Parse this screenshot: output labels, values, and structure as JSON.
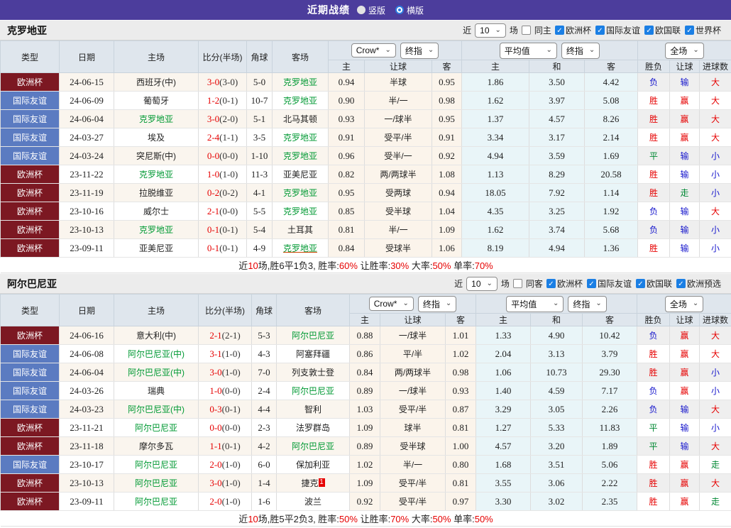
{
  "top_bar": {
    "title": "近期战绩",
    "radios": [
      {
        "label": "竖版",
        "selected": false
      },
      {
        "label": "横版",
        "selected": true
      }
    ]
  },
  "common": {
    "table_headers": {
      "type": "类型",
      "date": "日期",
      "home": "主场",
      "score": "比分(半场)",
      "corner": "角球",
      "away": "客场",
      "sub": [
        "主",
        "让球",
        "客",
        "主",
        "和",
        "客",
        "胜负",
        "让球",
        "进球数"
      ]
    },
    "selects": {
      "odds_source": "Crow*",
      "final1": "终指",
      "avg": "平均值",
      "final2": "终指",
      "scope": "全场"
    }
  },
  "sections": [
    {
      "team": "克罗地亚",
      "recent_label": "近",
      "recent_count": "10",
      "games_label": "场",
      "same_label": "同主",
      "leagues": [
        "欧洲杯",
        "国际友谊",
        "欧国联",
        "世界杯"
      ],
      "rows": [
        {
          "type": "欧洲杯",
          "tc": "e",
          "date": "24-06-15",
          "home": "西班牙(中)",
          "home_green": false,
          "score": "3-0",
          "half": "(3-0)",
          "corner": "5-0",
          "away": "克罗地亚",
          "away_green": true,
          "away_underline": false,
          "away_badge": "",
          "odds_home": "0.94",
          "handicap": "半球",
          "odds_away": "0.95",
          "avg_home": "1.86",
          "avg_draw": "3.50",
          "avg_away": "4.42",
          "res_wdl": "负",
          "res_wdl_c": "l",
          "res_let": "输",
          "res_let_c": "l",
          "res_goal": "大",
          "res_goal_c": "w"
        },
        {
          "type": "国际友谊",
          "tc": "f",
          "date": "24-06-09",
          "home": "葡萄牙",
          "home_green": false,
          "score": "1-2",
          "half": "(0-1)",
          "corner": "10-7",
          "away": "克罗地亚",
          "away_green": true,
          "away_underline": false,
          "away_badge": "",
          "odds_home": "0.90",
          "handicap": "半/一",
          "odds_away": "0.98",
          "avg_home": "1.62",
          "avg_draw": "3.97",
          "avg_away": "5.08",
          "res_wdl": "胜",
          "res_wdl_c": "w",
          "res_let": "赢",
          "res_let_c": "w",
          "res_goal": "大",
          "res_goal_c": "w"
        },
        {
          "type": "国际友谊",
          "tc": "f",
          "date": "24-06-04",
          "home": "克罗地亚",
          "home_green": true,
          "score": "3-0",
          "half": "(2-0)",
          "corner": "5-1",
          "away": "北马其顿",
          "away_green": false,
          "away_underline": false,
          "away_badge": "",
          "odds_home": "0.93",
          "handicap": "一/球半",
          "odds_away": "0.95",
          "avg_home": "1.37",
          "avg_draw": "4.57",
          "avg_away": "8.26",
          "res_wdl": "胜",
          "res_wdl_c": "w",
          "res_let": "赢",
          "res_let_c": "w",
          "res_goal": "大",
          "res_goal_c": "w"
        },
        {
          "type": "国际友谊",
          "tc": "f",
          "date": "24-03-27",
          "home": "埃及",
          "home_green": false,
          "score": "2-4",
          "half": "(1-1)",
          "corner": "3-5",
          "away": "克罗地亚",
          "away_green": true,
          "away_underline": false,
          "away_badge": "",
          "odds_home": "0.91",
          "handicap": "受平/半",
          "odds_away": "0.91",
          "avg_home": "3.34",
          "avg_draw": "3.17",
          "avg_away": "2.14",
          "res_wdl": "胜",
          "res_wdl_c": "w",
          "res_let": "赢",
          "res_let_c": "w",
          "res_goal": "大",
          "res_goal_c": "w"
        },
        {
          "type": "国际友谊",
          "tc": "f",
          "date": "24-03-24",
          "home": "突尼斯(中)",
          "home_green": false,
          "score": "0-0",
          "half": "(0-0)",
          "corner": "1-10",
          "away": "克罗地亚",
          "away_green": true,
          "away_underline": false,
          "away_badge": "",
          "odds_home": "0.96",
          "handicap": "受半/一",
          "odds_away": "0.92",
          "avg_home": "4.94",
          "avg_draw": "3.59",
          "avg_away": "1.69",
          "res_wdl": "平",
          "res_wdl_c": "d",
          "res_let": "输",
          "res_let_c": "l",
          "res_goal": "小",
          "res_goal_c": "l"
        },
        {
          "type": "欧洲杯",
          "tc": "e",
          "date": "23-11-22",
          "home": "克罗地亚",
          "home_green": true,
          "score": "1-0",
          "half": "(1-0)",
          "corner": "11-3",
          "away": "亚美尼亚",
          "away_green": false,
          "away_underline": false,
          "away_badge": "",
          "odds_home": "0.82",
          "handicap": "两/两球半",
          "odds_away": "1.08",
          "avg_home": "1.13",
          "avg_draw": "8.29",
          "avg_away": "20.58",
          "res_wdl": "胜",
          "res_wdl_c": "w",
          "res_let": "输",
          "res_let_c": "l",
          "res_goal": "小",
          "res_goal_c": "l"
        },
        {
          "type": "欧洲杯",
          "tc": "e",
          "date": "23-11-19",
          "home": "拉脱维亚",
          "home_green": false,
          "score": "0-2",
          "half": "(0-2)",
          "corner": "4-1",
          "away": "克罗地亚",
          "away_green": true,
          "away_underline": false,
          "away_badge": "",
          "odds_home": "0.95",
          "handicap": "受两球",
          "odds_away": "0.94",
          "avg_home": "18.05",
          "avg_draw": "7.92",
          "avg_away": "1.14",
          "res_wdl": "胜",
          "res_wdl_c": "w",
          "res_let": "走",
          "res_let_c": "d",
          "res_goal": "小",
          "res_goal_c": "l"
        },
        {
          "type": "欧洲杯",
          "tc": "e",
          "date": "23-10-16",
          "home": "威尔士",
          "home_green": false,
          "score": "2-1",
          "half": "(0-0)",
          "corner": "5-5",
          "away": "克罗地亚",
          "away_green": true,
          "away_underline": false,
          "away_badge": "",
          "odds_home": "0.85",
          "handicap": "受半球",
          "odds_away": "1.04",
          "avg_home": "4.35",
          "avg_draw": "3.25",
          "avg_away": "1.92",
          "res_wdl": "负",
          "res_wdl_c": "l",
          "res_let": "输",
          "res_let_c": "l",
          "res_goal": "大",
          "res_goal_c": "w"
        },
        {
          "type": "欧洲杯",
          "tc": "e",
          "date": "23-10-13",
          "home": "克罗地亚",
          "home_green": true,
          "score": "0-1",
          "half": "(0-1)",
          "corner": "5-4",
          "away": "土耳其",
          "away_green": false,
          "away_underline": false,
          "away_badge": "",
          "odds_home": "0.81",
          "handicap": "半/一",
          "odds_away": "1.09",
          "avg_home": "1.62",
          "avg_draw": "3.74",
          "avg_away": "5.68",
          "res_wdl": "负",
          "res_wdl_c": "l",
          "res_let": "输",
          "res_let_c": "l",
          "res_goal": "小",
          "res_goal_c": "l"
        },
        {
          "type": "欧洲杯",
          "tc": "e",
          "date": "23-09-11",
          "home": "亚美尼亚",
          "home_green": false,
          "score": "0-1",
          "half": "(0-1)",
          "corner": "4-9",
          "away": "克罗地亚",
          "away_green": true,
          "away_underline": true,
          "away_badge": "",
          "odds_home": "0.84",
          "handicap": "受球半",
          "odds_away": "1.06",
          "avg_home": "8.19",
          "avg_draw": "4.94",
          "avg_away": "1.36",
          "res_wdl": "胜",
          "res_wdl_c": "w",
          "res_let": "输",
          "res_let_c": "l",
          "res_goal": "小",
          "res_goal_c": "l"
        }
      ],
      "summary": [
        {
          "text": "近",
          "red": false
        },
        {
          "text": "10",
          "red": true
        },
        {
          "text": "场,胜6平1负3, 胜率:",
          "red": false
        },
        {
          "text": "60%",
          "red": true
        },
        {
          "text": " 让胜率:",
          "red": false
        },
        {
          "text": "30%",
          "red": true
        },
        {
          "text": " 大率:",
          "red": false
        },
        {
          "text": "50%",
          "red": true
        },
        {
          "text": " 单率:",
          "red": false
        },
        {
          "text": "70%",
          "red": true
        }
      ]
    },
    {
      "team": "阿尔巴尼亚",
      "recent_label": "近",
      "recent_count": "10",
      "games_label": "场",
      "same_label": "同客",
      "leagues": [
        "欧洲杯",
        "国际友谊",
        "欧国联",
        "欧洲预选"
      ],
      "rows": [
        {
          "type": "欧洲杯",
          "tc": "e",
          "date": "24-06-16",
          "home": "意大利(中)",
          "home_green": false,
          "score": "2-1",
          "half": "(2-1)",
          "corner": "5-3",
          "away": "阿尔巴尼亚",
          "away_green": true,
          "away_underline": false,
          "away_badge": "",
          "odds_home": "0.88",
          "handicap": "一/球半",
          "odds_away": "1.01",
          "avg_home": "1.33",
          "avg_draw": "4.90",
          "avg_away": "10.42",
          "res_wdl": "负",
          "res_wdl_c": "l",
          "res_let": "赢",
          "res_let_c": "w",
          "res_goal": "大",
          "res_goal_c": "w"
        },
        {
          "type": "国际友谊",
          "tc": "f",
          "date": "24-06-08",
          "home": "阿尔巴尼亚(中)",
          "home_green": true,
          "score": "3-1",
          "half": "(1-0)",
          "corner": "4-3",
          "away": "阿塞拜疆",
          "away_green": false,
          "away_underline": false,
          "away_badge": "",
          "odds_home": "0.86",
          "handicap": "平/半",
          "odds_away": "1.02",
          "avg_home": "2.04",
          "avg_draw": "3.13",
          "avg_away": "3.79",
          "res_wdl": "胜",
          "res_wdl_c": "w",
          "res_let": "赢",
          "res_let_c": "w",
          "res_goal": "大",
          "res_goal_c": "w"
        },
        {
          "type": "国际友谊",
          "tc": "f",
          "date": "24-06-04",
          "home": "阿尔巴尼亚(中)",
          "home_green": true,
          "score": "3-0",
          "half": "(1-0)",
          "corner": "7-0",
          "away": "列支敦士登",
          "away_green": false,
          "away_underline": false,
          "away_badge": "",
          "odds_home": "0.84",
          "handicap": "两/两球半",
          "odds_away": "0.98",
          "avg_home": "1.06",
          "avg_draw": "10.73",
          "avg_away": "29.30",
          "res_wdl": "胜",
          "res_wdl_c": "w",
          "res_let": "赢",
          "res_let_c": "w",
          "res_goal": "小",
          "res_goal_c": "l"
        },
        {
          "type": "国际友谊",
          "tc": "f",
          "date": "24-03-26",
          "home": "瑞典",
          "home_green": false,
          "score": "1-0",
          "half": "(0-0)",
          "corner": "2-4",
          "away": "阿尔巴尼亚",
          "away_green": true,
          "away_underline": false,
          "away_badge": "",
          "odds_home": "0.89",
          "handicap": "一/球半",
          "odds_away": "0.93",
          "avg_home": "1.40",
          "avg_draw": "4.59",
          "avg_away": "7.17",
          "res_wdl": "负",
          "res_wdl_c": "l",
          "res_let": "赢",
          "res_let_c": "w",
          "res_goal": "小",
          "res_goal_c": "l"
        },
        {
          "type": "国际友谊",
          "tc": "f",
          "date": "24-03-23",
          "home": "阿尔巴尼亚(中)",
          "home_green": true,
          "score": "0-3",
          "half": "(0-1)",
          "corner": "4-4",
          "away": "智利",
          "away_green": false,
          "away_underline": false,
          "away_badge": "",
          "odds_home": "1.03",
          "handicap": "受平/半",
          "odds_away": "0.87",
          "avg_home": "3.29",
          "avg_draw": "3.05",
          "avg_away": "2.26",
          "res_wdl": "负",
          "res_wdl_c": "l",
          "res_let": "输",
          "res_let_c": "l",
          "res_goal": "大",
          "res_goal_c": "w"
        },
        {
          "type": "欧洲杯",
          "tc": "e",
          "date": "23-11-21",
          "home": "阿尔巴尼亚",
          "home_green": true,
          "score": "0-0",
          "half": "(0-0)",
          "corner": "2-3",
          "away": "法罗群岛",
          "away_green": false,
          "away_underline": false,
          "away_badge": "",
          "odds_home": "1.09",
          "handicap": "球半",
          "odds_away": "0.81",
          "avg_home": "1.27",
          "avg_draw": "5.33",
          "avg_away": "11.83",
          "res_wdl": "平",
          "res_wdl_c": "d",
          "res_let": "输",
          "res_let_c": "l",
          "res_goal": "小",
          "res_goal_c": "l"
        },
        {
          "type": "欧洲杯",
          "tc": "e",
          "date": "23-11-18",
          "home": "摩尔多瓦",
          "home_green": false,
          "score": "1-1",
          "half": "(0-1)",
          "corner": "4-2",
          "away": "阿尔巴尼亚",
          "away_green": true,
          "away_underline": false,
          "away_badge": "",
          "odds_home": "0.89",
          "handicap": "受半球",
          "odds_away": "1.00",
          "avg_home": "4.57",
          "avg_draw": "3.20",
          "avg_away": "1.89",
          "res_wdl": "平",
          "res_wdl_c": "d",
          "res_let": "输",
          "res_let_c": "l",
          "res_goal": "大",
          "res_goal_c": "w"
        },
        {
          "type": "国际友谊",
          "tc": "f",
          "date": "23-10-17",
          "home": "阿尔巴尼亚",
          "home_green": true,
          "score": "2-0",
          "half": "(1-0)",
          "corner": "6-0",
          "away": "保加利亚",
          "away_green": false,
          "away_underline": false,
          "away_badge": "",
          "odds_home": "1.02",
          "handicap": "半/一",
          "odds_away": "0.80",
          "avg_home": "1.68",
          "avg_draw": "3.51",
          "avg_away": "5.06",
          "res_wdl": "胜",
          "res_wdl_c": "w",
          "res_let": "赢",
          "res_let_c": "w",
          "res_goal": "走",
          "res_goal_c": "d"
        },
        {
          "type": "欧洲杯",
          "tc": "e",
          "date": "23-10-13",
          "home": "阿尔巴尼亚",
          "home_green": true,
          "score": "3-0",
          "half": "(1-0)",
          "corner": "1-4",
          "away": "捷克",
          "away_green": false,
          "away_underline": false,
          "away_badge": "1",
          "odds_home": "1.09",
          "handicap": "受平/半",
          "odds_away": "0.81",
          "avg_home": "3.55",
          "avg_draw": "3.06",
          "avg_away": "2.22",
          "res_wdl": "胜",
          "res_wdl_c": "w",
          "res_let": "赢",
          "res_let_c": "w",
          "res_goal": "大",
          "res_goal_c": "w"
        },
        {
          "type": "欧洲杯",
          "tc": "e",
          "date": "23-09-11",
          "home": "阿尔巴尼亚",
          "home_green": true,
          "score": "2-0",
          "half": "(1-0)",
          "corner": "1-6",
          "away": "波兰",
          "away_green": false,
          "away_underline": false,
          "away_badge": "",
          "odds_home": "0.92",
          "handicap": "受平/半",
          "odds_away": "0.97",
          "avg_home": "3.30",
          "avg_draw": "3.02",
          "avg_away": "2.35",
          "res_wdl": "胜",
          "res_wdl_c": "w",
          "res_let": "赢",
          "res_let_c": "w",
          "res_goal": "走",
          "res_goal_c": "d"
        }
      ],
      "summary": [
        {
          "text": "近",
          "red": false
        },
        {
          "text": "10",
          "red": true
        },
        {
          "text": "场,胜5平2负3, 胜率:",
          "red": false
        },
        {
          "text": "50%",
          "red": true
        },
        {
          "text": " 让胜率:",
          "red": false
        },
        {
          "text": "70%",
          "red": true
        },
        {
          "text": " 大率:",
          "red": false
        },
        {
          "text": "50%",
          "red": true
        },
        {
          "text": " 单率:",
          "red": false
        },
        {
          "text": "50%",
          "red": true
        }
      ]
    }
  ]
}
